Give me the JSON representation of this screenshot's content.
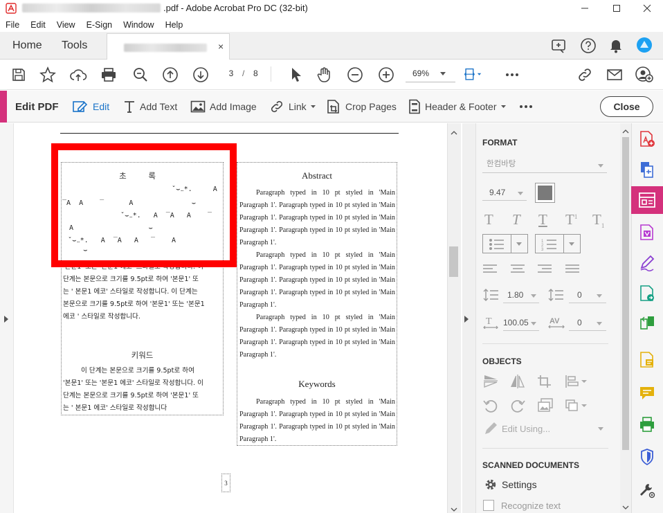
{
  "window": {
    "title_suffix": ".pdf - Adobe Acrobat Pro DC (32-bit)",
    "controls": [
      "minimize",
      "maximize",
      "close"
    ]
  },
  "menu": [
    "File",
    "Edit",
    "View",
    "E-Sign",
    "Window",
    "Help"
  ],
  "tabs": {
    "home": "Home",
    "tools": "Tools",
    "doc_close": "×"
  },
  "toolbar": {
    "page_current": "3",
    "page_separator": "/",
    "page_total": "8",
    "zoom": "69%"
  },
  "edit_bar": {
    "title": "Edit PDF",
    "edit": "Edit",
    "add_text": "Add Text",
    "add_image": "Add Image",
    "link": "Link",
    "crop_pages": "Crop Pages",
    "header_footer": "Header & Footer",
    "close": "Close"
  },
  "document": {
    "korean_abstract_title": "초 록",
    "korean_abstract_lines": [
      "'본문1' 또는 '본문1 에코' 스타일로 작성합니다. 이",
      "단계는 본문으로 크기를 9.5pt로 하여 '본문1' 또",
      "는 ' 본문1 에코' 스타일로 작성합니다. 이 단계는",
      "본문으로 크기를 9.5pt로 하여 '본문1' 또는 '본문1",
      "에코 ' 스타일로 작성합니다."
    ],
    "korean_keywords_title": "키워드",
    "korean_keywords_lines": [
      "이 단계는 본문으로 크기를 9.5pt로 하여",
      "'본문1' 또는 '본문1 에코' 스타일로 작성합니다. 이",
      "단계는 본문으로 크기를 9.5pt로 하여 '본문1' 또",
      "는 ' 본문1 에코' 스타일로 작성합니다"
    ],
    "abstract_title": "Abstract",
    "abstract_paragraphs": [
      "Paragraph typed in 10 pt styled in 'Main Paragraph 1'. Paragraph typed in 10 pt styled in 'Main Paragraph 1'. Paragraph typed in 10 pt styled in 'Main Paragraph 1'. Paragraph typed in 10 pt styled in 'Main Paragraph 1'.",
      "Paragraph typed in 10 pt styled in 'Main Paragraph 1'. Paragraph typed in 10 pt styled in 'Main Paragraph 1'. Paragraph typed in 10 pt styled in 'Main Paragraph 1'. Paragraph typed in 10 pt    styled in 'Main Paragraph 1'.",
      "Paragraph typed in 10 pt styled in 'Main Paragraph 1'. Paragraph typed in 10 pt styled in 'Main Paragraph 1'. Paragraph    typed in 10 pt styled in 'Main Paragraph 1'."
    ],
    "keywords_title": "Keywords",
    "keywords_paragraph": "Paragraph typed in 10 pt styled in 'Main Paragraph 1'. Paragraph typed in 10 pt styled in 'Main Paragraph 1'. Paragraph typed in 10 pt styled in 'Main Paragraph 1'.",
    "page_number": "3"
  },
  "panel": {
    "format_header": "FORMAT",
    "font_name": "한컴바탕",
    "font_size": "9.47",
    "line_spacing": "1.80",
    "para_spacing": "0",
    "horizontal_scale": "100.05",
    "char_spacing": "0",
    "objects_header": "OBJECTS",
    "edit_using": "Edit Using...",
    "scanned_header": "SCANNED DOCUMENTS",
    "settings": "Settings",
    "recognize_text": "Recognize text"
  },
  "colors": {
    "accent": "#d4317c",
    "highlight_box": "#ff0000"
  }
}
